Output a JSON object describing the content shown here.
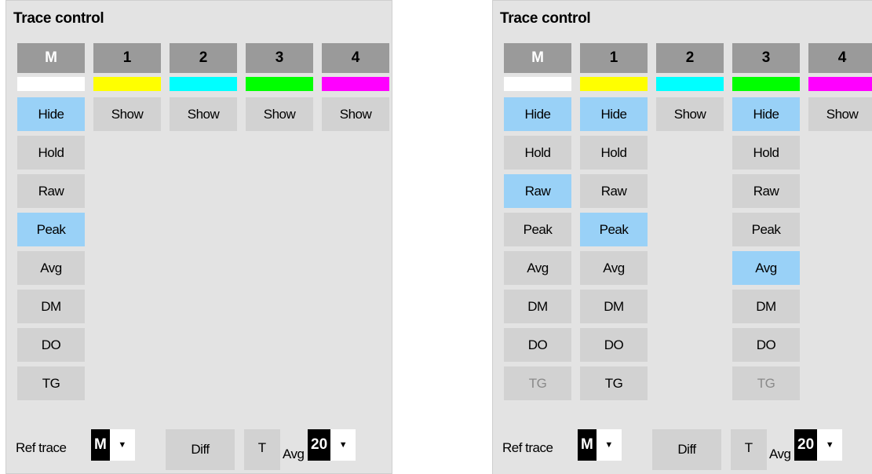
{
  "colors": {
    "panel_bg": "#e3e3e3",
    "button_bg": "#d2d2d2",
    "button_active": "#99d1f7",
    "header_bg": "#9a9a9a",
    "trace_M": "#ffffff",
    "trace_1": "#ffff00",
    "trace_2": "#00ffff",
    "trace_3": "#00ff00",
    "trace_4": "#ff00ff"
  },
  "left_panel": {
    "title": "Trace control",
    "columns": [
      {
        "header": "M",
        "show_hide": "Hide",
        "show_hide_active": true,
        "buttons": [
          {
            "label": "Hold",
            "active": false
          },
          {
            "label": "Raw",
            "active": false
          },
          {
            "label": "Peak",
            "active": true
          },
          {
            "label": "Avg",
            "active": false
          },
          {
            "label": "DM",
            "active": false
          },
          {
            "label": "DO",
            "active": false
          },
          {
            "label": "TG",
            "active": false
          }
        ]
      },
      {
        "header": "1",
        "show_hide": "Show",
        "show_hide_active": false,
        "buttons": []
      },
      {
        "header": "2",
        "show_hide": "Show",
        "show_hide_active": false,
        "buttons": []
      },
      {
        "header": "3",
        "show_hide": "Show",
        "show_hide_active": false,
        "buttons": []
      },
      {
        "header": "4",
        "show_hide": "Show",
        "show_hide_active": false,
        "buttons": []
      }
    ],
    "ref_trace_label": "Ref trace",
    "ref_trace_value": "M",
    "diff_label": "Diff",
    "t_label": "T",
    "avg_label": "Avg",
    "avg_value": "20"
  },
  "right_panel": {
    "title": "Trace control",
    "columns": [
      {
        "header": "M",
        "show_hide": "Hide",
        "show_hide_active": true,
        "buttons": [
          {
            "label": "Hold",
            "active": false
          },
          {
            "label": "Raw",
            "active": true
          },
          {
            "label": "Peak",
            "active": false
          },
          {
            "label": "Avg",
            "active": false
          },
          {
            "label": "DM",
            "active": false
          },
          {
            "label": "DO",
            "active": false
          },
          {
            "label": "TG",
            "active": false,
            "disabled": true
          }
        ]
      },
      {
        "header": "1",
        "show_hide": "Hide",
        "show_hide_active": true,
        "buttons": [
          {
            "label": "Hold",
            "active": false
          },
          {
            "label": "Raw",
            "active": false
          },
          {
            "label": "Peak",
            "active": true
          },
          {
            "label": "Avg",
            "active": false
          },
          {
            "label": "DM",
            "active": false
          },
          {
            "label": "DO",
            "active": false
          },
          {
            "label": "TG",
            "active": false
          }
        ]
      },
      {
        "header": "2",
        "show_hide": "Show",
        "show_hide_active": false,
        "buttons": []
      },
      {
        "header": "3",
        "show_hide": "Hide",
        "show_hide_active": true,
        "buttons": [
          {
            "label": "Hold",
            "active": false
          },
          {
            "label": "Raw",
            "active": false
          },
          {
            "label": "Peak",
            "active": false
          },
          {
            "label": "Avg",
            "active": true
          },
          {
            "label": "DM",
            "active": false
          },
          {
            "label": "DO",
            "active": false
          },
          {
            "label": "TG",
            "active": false,
            "disabled": true
          }
        ]
      },
      {
        "header": "4",
        "show_hide": "Show",
        "show_hide_active": false,
        "buttons": []
      }
    ],
    "ref_trace_label": "Ref trace",
    "ref_trace_value": "M",
    "diff_label": "Diff",
    "t_label": "T",
    "avg_label": "Avg",
    "avg_value": "20"
  }
}
